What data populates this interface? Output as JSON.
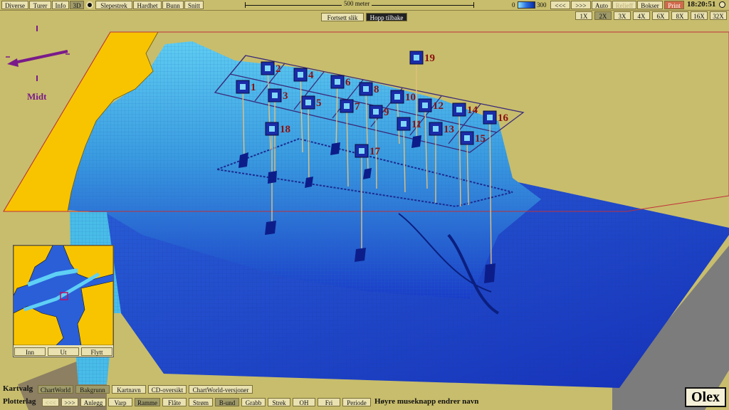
{
  "menu": [
    "Diverse",
    "Turer",
    "Info",
    "3D",
    "Slepestrek",
    "Hardhet",
    "Bunn",
    "Snitt"
  ],
  "scale_label": "500 meter",
  "depth_min": "0",
  "depth_max": "300",
  "nav": {
    "back": "<<<",
    "forward": ">>>",
    "auto": "Auto",
    "relieff": "Relieff",
    "bokser": "Bokser",
    "print": "Print"
  },
  "clock": "18:20:51",
  "tour": {
    "continue": "Fortsett slik",
    "jump_back": "Hopp tilbake"
  },
  "speeds": [
    "1X",
    "2X",
    "3X",
    "4X",
    "6X",
    "8X",
    "16X",
    "32X"
  ],
  "speed_selected": "2X",
  "compass_label": "Midt",
  "markers": [
    "1",
    "2",
    "3",
    "4",
    "5",
    "6",
    "7",
    "8",
    "9",
    "10",
    "11",
    "12",
    "13",
    "14",
    "15",
    "16",
    "17",
    "18",
    "19"
  ],
  "inset": {
    "in": "Inn",
    "out": "Ut",
    "move": "Flytt"
  },
  "kartvalg": {
    "label": "Kartvalg",
    "items": [
      "ChartWorld",
      "Bakgrunn",
      "Kartnavn",
      "CD-oversikt",
      "ChartWorld-versjoner"
    ]
  },
  "plotterlag": {
    "label": "Plotterlag",
    "back": "<<<",
    "forward": ">>>",
    "items": [
      "Anlegg",
      "Varp",
      "Ramme",
      "Flåte",
      "Strøm",
      "B-und",
      "Grabb",
      "Strek",
      "OH",
      "Fri",
      "Periode"
    ],
    "hint": "Høyre museknapp endrer navn"
  },
  "logo": "Olex",
  "colors": {
    "land": "#f8c400",
    "sea_shallow": "#4fc3ee",
    "sea_deep": "#1e3fc8",
    "grid": "#3a2a7a",
    "marker_fill": "#1a2ca8",
    "marker_label": "#8b1010",
    "compass": "#7a1a8a"
  }
}
